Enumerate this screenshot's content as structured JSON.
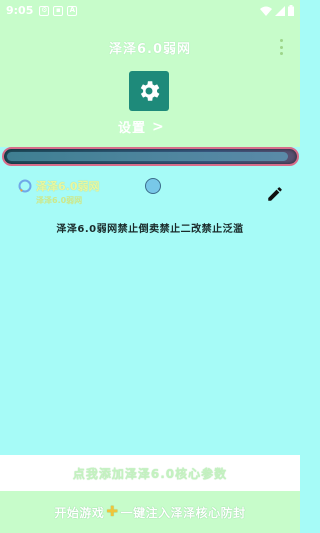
{
  "status_bar": {
    "time": "9:05",
    "icons": [
      "settings-icon",
      "image-icon",
      "a-icon"
    ],
    "right_icons": [
      "wifi-icon",
      "signal-icon",
      "battery-icon"
    ]
  },
  "app": {
    "title": "泽泽6.0弱网",
    "settings_label": "设置",
    "settings_chevron": ">"
  },
  "progress": {
    "fraction": 0.98
  },
  "card": {
    "title": "泽泽6.0弱网",
    "subtitle": "泽泽6.0弱网"
  },
  "announcement": "泽泽6.0弱网禁止倒卖禁止二改禁止泛滥",
  "bottom": {
    "add_params": "点我添加泽泽6.0核心参数",
    "start_prefix": "开始游戏",
    "start_suffix": "一键注入泽泽核心防封"
  },
  "colors": {
    "background": "#a6fbf7",
    "header": "#c7fcca",
    "settings_tile": "#1e8a7a",
    "progress_border": "#d76d8a"
  }
}
